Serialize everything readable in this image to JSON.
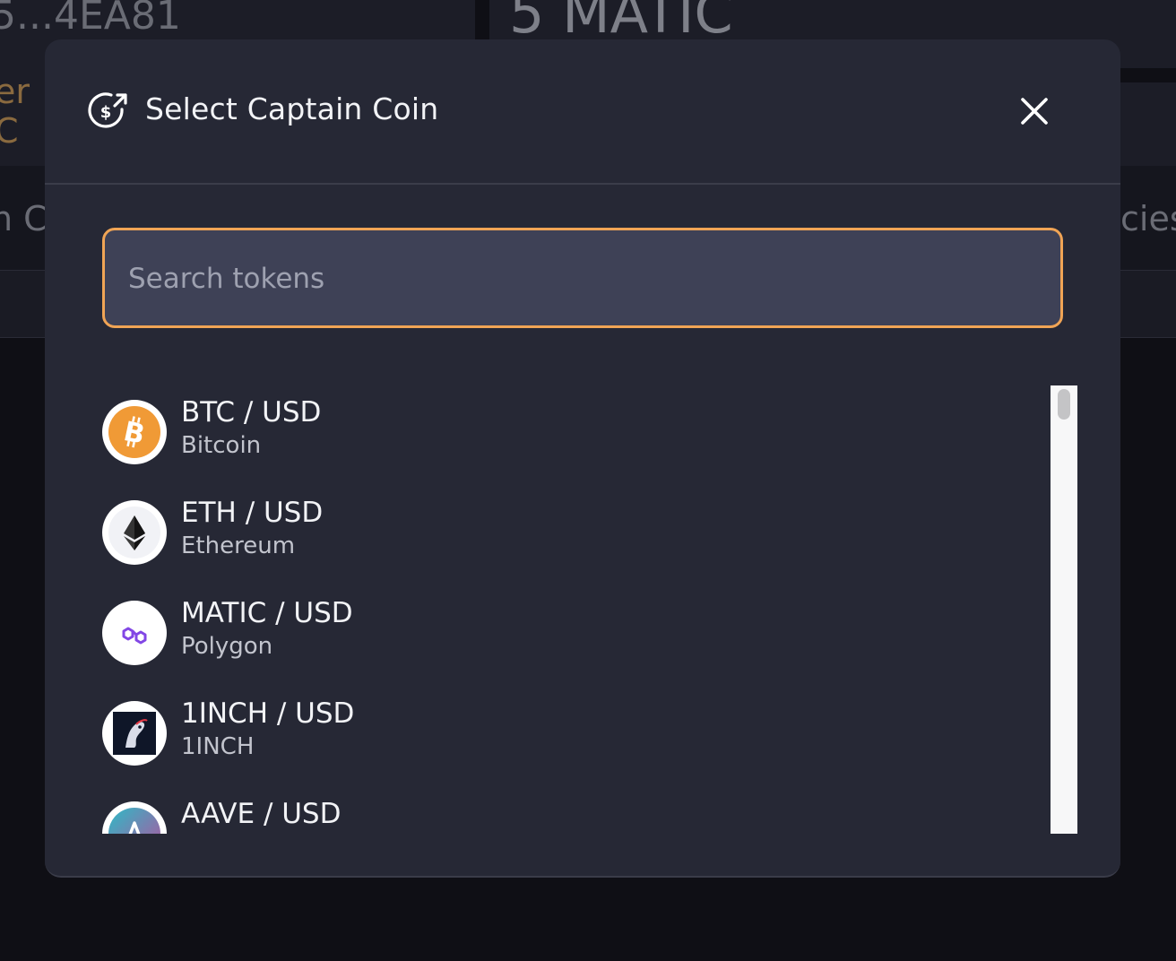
{
  "background": {
    "address_fragment": "5...4EA81",
    "amount_fragment": "5 MATIC",
    "label_fragment_1": "er",
    "label_fragment_2": "C",
    "tab_left_fragment": "n C",
    "tab_right_fragment": "cies"
  },
  "modal": {
    "title": "Select Captain Coin",
    "title_icon": "dollar-exchange-icon",
    "close_icon": "close-icon",
    "search": {
      "placeholder": "Search tokens",
      "value": ""
    },
    "tokens": [
      {
        "pair": "BTC / USD",
        "name": "Bitcoin",
        "icon": "bitcoin-icon"
      },
      {
        "pair": "ETH / USD",
        "name": "Ethereum",
        "icon": "ethereum-icon"
      },
      {
        "pair": "MATIC / USD",
        "name": "Polygon",
        "icon": "polygon-icon"
      },
      {
        "pair": "1INCH / USD",
        "name": "1INCH",
        "icon": "1inch-icon"
      },
      {
        "pair": "AAVE / USD",
        "name": "",
        "icon": "aave-icon"
      }
    ]
  },
  "colors": {
    "modal_bg": "#262835",
    "search_border": "#f0a455",
    "bitcoin": "#f09a36",
    "polygon": "#8247e5"
  }
}
